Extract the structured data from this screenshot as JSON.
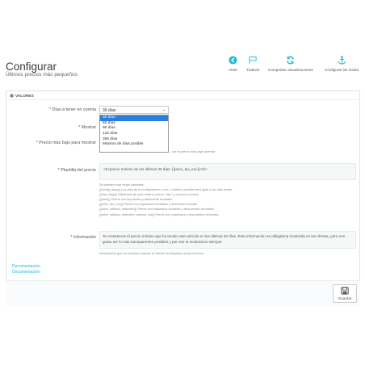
{
  "header": {
    "title": "Configurar",
    "subtitle": "Últimos precios más pequeños"
  },
  "toolbar": {
    "back_label": "Atrás",
    "translate_label": "Traducir",
    "check_updates_label": "Comprobar actualizaciones",
    "configure_hooks_label": "Configurar los hooks"
  },
  "panel": {
    "heading": "VALORES"
  },
  "form": {
    "days_label": "* Días a tener en cuenta",
    "show_label": "* Mostrar",
    "lowest_price_label": "* Precio más bajo para mostrar",
    "template_label": "* Plantilla del precio",
    "info_label": "* Información",
    "days_select": {
      "selected": "30 días",
      "options": [
        "30 días",
        "60 días",
        "90 días",
        "120 días",
        "365 días",
        "Máximo de días posible"
      ]
    },
    "lowest_price_hint": "...rar el precio más bajo anterior",
    "template_value": "<b>precio mínimo de los últimos 30 días: {{price_tax_exc}}</b>",
    "variables": [
      "Se pueden usar estas variables:",
      "{{config_days}} Los días de la configuración, si es > máximo posible será igual a los días reales",
      "{{real_days}} Diferencia de días entre el precio \"hoy\" y el precio mínimo",
      "{{price}} Precio con impuestos y descuento incluidos",
      "{{price_tax_exc}} Precio con impuestos excluidos y descuento incluido",
      "{{price_without_reduction}} Precio con impuestos incluidos y descuentos excluidos",
      "{{price_without_reduction_without_tax}} Precio con impuestos y descuentos excluidos"
    ],
    "info_value": "Te mostramos el precio mínimo que ha tenido este artículo en los últimos 30 días. Esta información es obligatoria mostrarla en las ofertas, pero nos gusta ser lo más transparentes posibles y por ese la mostramos siempre",
    "info_hint": "Información que se muestra cuando el cliente se desplaza sobre el icono"
  },
  "links": {
    "documentation_1": "Documentación",
    "documentation_2": "Documentación"
  },
  "footer": {
    "save_label": "Guardar"
  },
  "colors": {
    "accent": "#25b9d7",
    "selected_option": "#2a7de1"
  }
}
